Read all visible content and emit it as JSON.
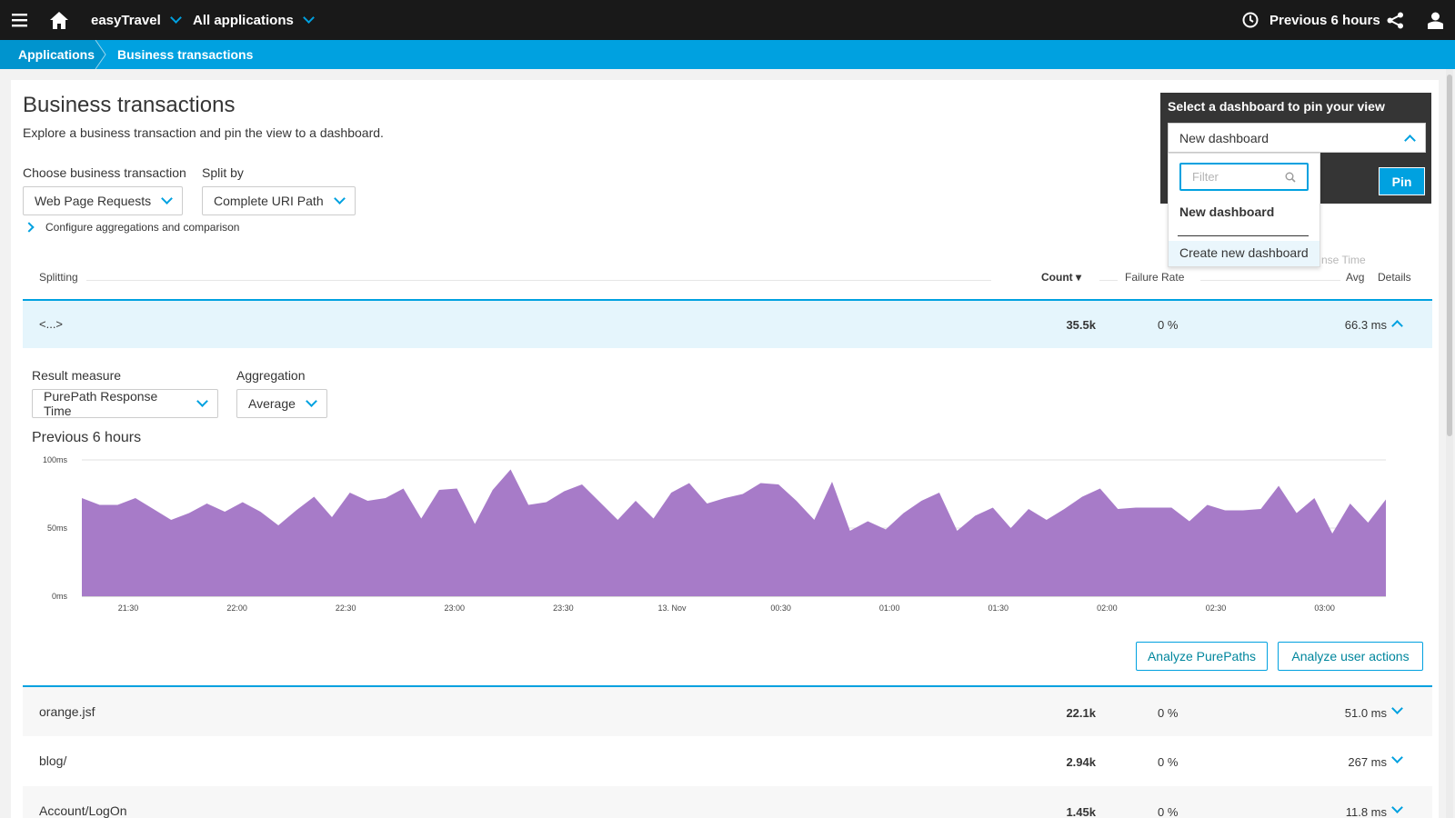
{
  "topbar": {
    "app": "easyTravel",
    "scope": "All applications",
    "timeframe": "Previous 6 hours"
  },
  "breadcrumb": [
    "Applications",
    "Business transactions"
  ],
  "page": {
    "title": "Business transactions",
    "subtitle": "Explore a business transaction and pin the view to a dashboard.",
    "choose_label": "Choose business transaction",
    "choose_value": "Web Page Requests",
    "split_label": "Split by",
    "split_value": "Complete URI Path",
    "configure_label": "Configure aggregations and comparison"
  },
  "table": {
    "headers": {
      "splitting": "Splitting",
      "count": "Count ▾",
      "failure_rate": "Failure Rate",
      "avg": "Avg",
      "details": "Details",
      "response_time_partial": "nse Time"
    },
    "expanded_row": {
      "name": "<...>",
      "count": "35.5k",
      "failure": "0 %",
      "avg": "66.3 ms"
    },
    "rows": [
      {
        "name": "orange.jsf",
        "count": "22.1k",
        "failure": "0 %",
        "avg": "51.0 ms"
      },
      {
        "name": "blog/",
        "count": "2.94k",
        "failure": "0 %",
        "avg": "267 ms"
      },
      {
        "name": "Account/LogOn",
        "count": "1.45k",
        "failure": "0 %",
        "avg": "11.8 ms"
      }
    ]
  },
  "details": {
    "result_label": "Result measure",
    "result_value": "PurePath Response Time",
    "agg_label": "Aggregation",
    "agg_value": "Average",
    "period": "Previous 6 hours",
    "analyze_purepaths": "Analyze PurePaths",
    "analyze_user_actions": "Analyze user actions"
  },
  "pin": {
    "title": "Select a dashboard to pin your view",
    "selected": "New dashboard",
    "button": "Pin",
    "filter_placeholder": "Filter",
    "group": "New dashboard",
    "create": "Create new dashboard"
  },
  "chart_data": {
    "type": "area",
    "color": "#a77bc8",
    "y_ticks": [
      "100ms",
      "50ms",
      "0ms"
    ],
    "ylim": [
      0,
      100
    ],
    "x_ticks": [
      "21:30",
      "22:00",
      "22:30",
      "23:00",
      "23:30",
      "13. Nov",
      "00:30",
      "01:00",
      "01:30",
      "02:00",
      "02:30",
      "03:00"
    ],
    "values": [
      72,
      67,
      67,
      72,
      64,
      56,
      61,
      68,
      62,
      69,
      62,
      52,
      63,
      73,
      58,
      76,
      70,
      72,
      79,
      57,
      78,
      79,
      53,
      78,
      93,
      67,
      69,
      77,
      82,
      69,
      56,
      70,
      57,
      76,
      83,
      68,
      72,
      75,
      83,
      82,
      70,
      56,
      84,
      48,
      55,
      49,
      61,
      70,
      76,
      48,
      59,
      65,
      50,
      64,
      56,
      64,
      73,
      79,
      64,
      65,
      65,
      65,
      55,
      67,
      63,
      63,
      64,
      81,
      61,
      72,
      46,
      68,
      54,
      71
    ]
  }
}
